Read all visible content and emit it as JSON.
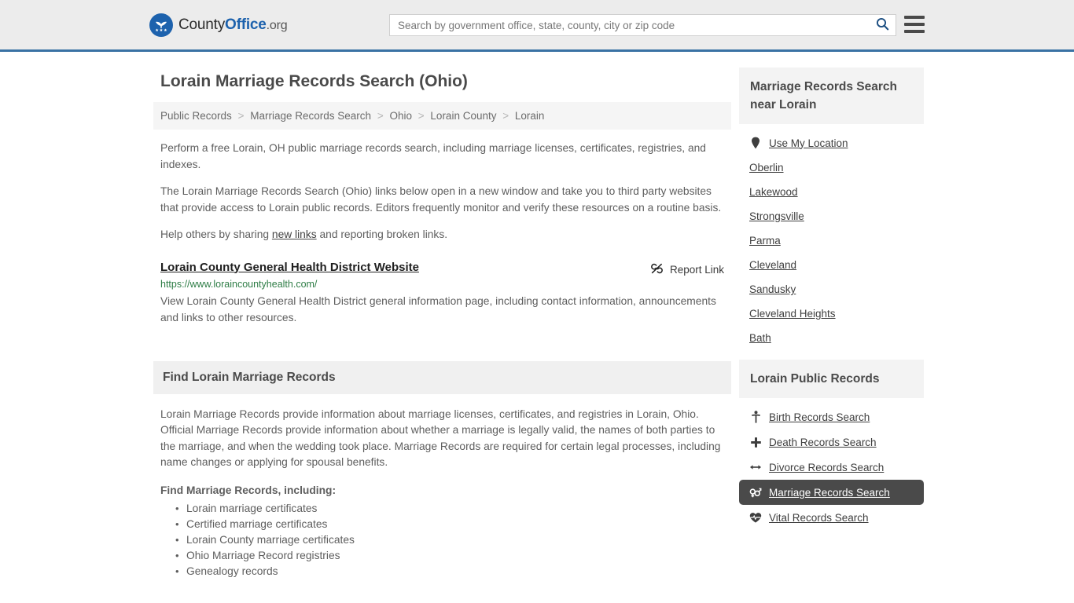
{
  "header": {
    "brand": {
      "part1": "County",
      "part2": "Office",
      "part3": ".org",
      "logo_icon": "eagle-seal-logo"
    },
    "search": {
      "placeholder": "Search by government office, state, county, city or zip code",
      "value": "",
      "search_icon": "magnifier-icon"
    },
    "menu_icon": "hamburger-menu-icon",
    "accent_color": "#3a72a4"
  },
  "main": {
    "title": "Lorain Marriage Records Search (Ohio)",
    "breadcrumb": [
      "Public Records",
      "Marriage Records Search",
      "Ohio",
      "Lorain County",
      "Lorain"
    ],
    "breadcrumb_separator": ">",
    "intro_paragraph": "Perform a free Lorain, OH public marriage records search, including marriage licenses, certificates, registries, and indexes.",
    "links_paragraph": "The Lorain Marriage Records Search (Ohio) links below open in a new window and take you to third party websites that provide access to Lorain public records. Editors frequently monitor and verify these resources on a routine basis.",
    "help_prefix": "Help others by sharing ",
    "help_link": "new links",
    "help_suffix": " and reporting broken links.",
    "result": {
      "title": "Lorain County General Health District Website",
      "report_label": "Report Link",
      "report_icon": "broken-link-icon",
      "url": "https://www.loraincountyhealth.com/",
      "url_color": "#2e7d46",
      "description": "View Lorain County General Health District general information page, including contact information, announcements and links to other resources."
    },
    "section": {
      "heading": "Find Lorain Marriage Records",
      "body": "Lorain Marriage Records provide information about marriage licenses, certificates, and registries in Lorain, Ohio. Official Marriage Records provide information about whether a marriage is legally valid, the names of both parties to the marriage, and when the wedding took place. Marriage Records are required for certain legal processes, including name changes or applying for spousal benefits.",
      "sub_heading": "Find Marriage Records, including:",
      "items": [
        "Lorain marriage certificates",
        "Certified marriage certificates",
        "Lorain County marriage certificates",
        "Ohio Marriage Record registries",
        "Genealogy records"
      ]
    }
  },
  "sidebar": {
    "nearby": {
      "heading": "Marriage Records Search near Lorain",
      "items": [
        {
          "label": "Use My Location",
          "icon": "map-pin-icon",
          "has_icon": true
        },
        {
          "label": "Oberlin",
          "icon": "",
          "has_icon": false
        },
        {
          "label": "Lakewood",
          "icon": "",
          "has_icon": false
        },
        {
          "label": "Strongsville",
          "icon": "",
          "has_icon": false
        },
        {
          "label": "Parma",
          "icon": "",
          "has_icon": false
        },
        {
          "label": "Cleveland",
          "icon": "",
          "has_icon": false
        },
        {
          "label": "Sandusky",
          "icon": "",
          "has_icon": false
        },
        {
          "label": "Cleveland Heights",
          "icon": "",
          "has_icon": false
        },
        {
          "label": "Bath",
          "icon": "",
          "has_icon": false
        }
      ]
    },
    "public_records": {
      "heading": "Lorain Public Records",
      "active_index": 3,
      "active_color": "#4a4a4a",
      "items": [
        {
          "label": "Birth Records Search",
          "icon": "baby-icon"
        },
        {
          "label": "Death Records Search",
          "icon": "cross-icon"
        },
        {
          "label": "Divorce Records Search",
          "icon": "left-right-arrow-icon"
        },
        {
          "label": "Marriage Records Search",
          "icon": "venus-mars-icon"
        },
        {
          "label": "Vital Records Search",
          "icon": "heart-pulse-icon"
        }
      ]
    }
  }
}
